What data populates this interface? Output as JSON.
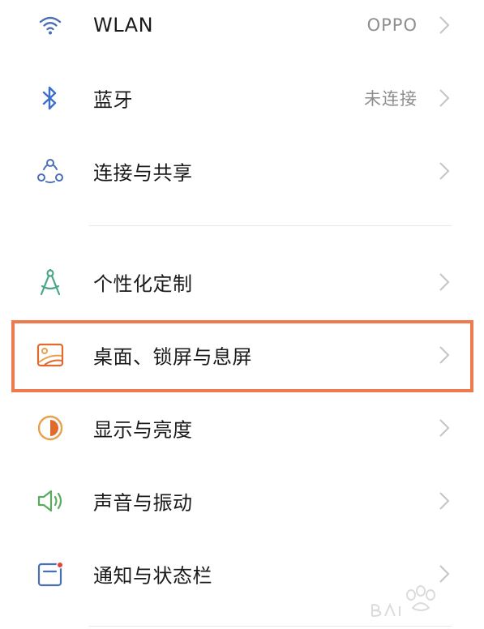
{
  "settings": {
    "items": [
      {
        "label": "WLAN",
        "value": "OPPO",
        "icon": "wifi-icon"
      },
      {
        "label": "蓝牙",
        "value": "未连接",
        "icon": "bluetooth-icon"
      },
      {
        "label": "连接与共享",
        "icon": "share-connect-icon"
      },
      {
        "label": "个性化定制",
        "icon": "compass-icon"
      },
      {
        "label": "桌面、锁屏与息屏",
        "icon": "wallpaper-icon"
      },
      {
        "label": "显示与亮度",
        "icon": "brightness-icon"
      },
      {
        "label": "声音与振动",
        "icon": "speaker-icon"
      },
      {
        "label": "通知与状态栏",
        "icon": "notification-icon"
      }
    ]
  },
  "colors": {
    "highlight": "#ee7a4d",
    "wifi": "#4a6fb5",
    "bluetooth": "#3b6fc9",
    "compass": "#4aa68a",
    "wallpaper": "#e06a2c",
    "brightness": "#e8a14a",
    "speaker": "#5aab5e",
    "notification": "#4a6fb5"
  }
}
